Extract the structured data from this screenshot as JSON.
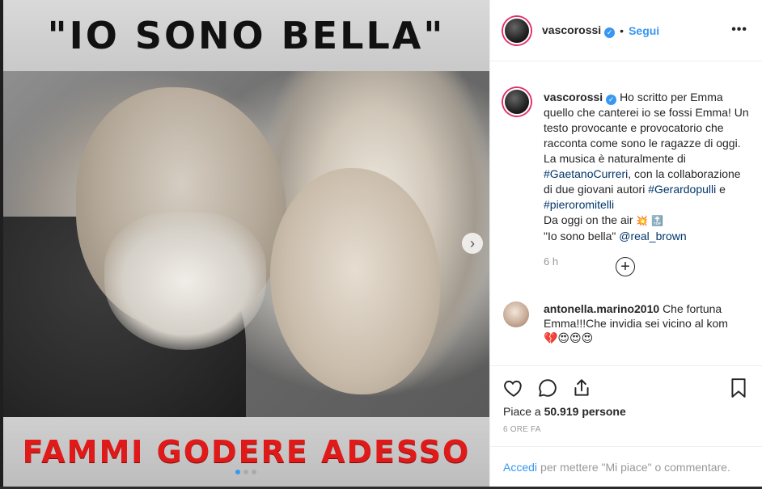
{
  "media": {
    "title_top": "\"Io sono bella\"",
    "title_bottom": "Fammi godere adesso",
    "next_glyph": "›",
    "carousel_dots": 3,
    "active_dot": 0
  },
  "header": {
    "username": "vascorossi",
    "verified_glyph": "✓",
    "separator": "•",
    "follow_label": "Segui",
    "more_glyph": "•••"
  },
  "caption": {
    "username": "vascorossi",
    "text_1": "Ho scritto per Emma quello che canterei io se fossi Emma! Un testo provocante e provocatorio che racconta come sono le ragazze di oggi. La musica è naturalmente di",
    "tag_1": "#GaetanoCurreri",
    "text_2": ", con la collaborazione di due giovani autori",
    "tag_2": "#Gerardopulli",
    "text_3": "e",
    "tag_3": "#pieroromitelli",
    "text_4": "Da oggi on the air",
    "emoji_1": "💥",
    "emoji_2": "🔝",
    "text_5": "\"Io sono bella\"",
    "mention": "@real_brown",
    "time": "6 h"
  },
  "load_more_glyph": "+",
  "comment": {
    "username": "antonella.marino2010",
    "text": "Che fortuna Emma!!!Che invidia sei vicino al kom",
    "emojis": "💔😍😍😍"
  },
  "actions": {
    "likes_prefix": "Piace a",
    "likes_count": "50.919",
    "likes_suffix": "persone",
    "timestamp": "6 ORE FA"
  },
  "add_comment": {
    "link": "Accedi",
    "rest": "per mettere \"Mi piace\" o commentare."
  },
  "colors": {
    "accent": "#3897f0",
    "red_text": "#e01919",
    "muted": "#999999"
  }
}
